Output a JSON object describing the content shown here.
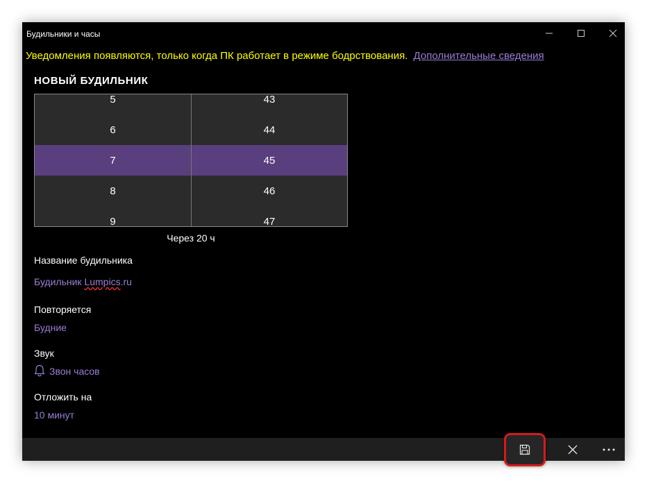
{
  "window": {
    "title": "Будильники и часы"
  },
  "notice": {
    "text": "Уведомления появляются, только когда ПК работает в режиме бодрствования.",
    "link": "Дополнительные сведения"
  },
  "page": {
    "heading": "НОВЫЙ БУДИЛЬНИК"
  },
  "time_picker": {
    "hours": [
      "5",
      "6",
      "7",
      "8",
      "9"
    ],
    "minutes": [
      "43",
      "44",
      "45",
      "46",
      "47"
    ],
    "selected_hour": "7",
    "selected_minute": "45",
    "remaining": "Через 20 ч"
  },
  "fields": {
    "name_label": "Название будильника",
    "name_prefix": "Будильник ",
    "name_misspelled": "Lumpics",
    "name_suffix": ".ru",
    "repeat_label": "Повторяется",
    "repeat_value": "Будние",
    "sound_label": "Звук",
    "sound_value": "Звон часов",
    "snooze_label": "Отложить на",
    "snooze_value": "10 минут"
  },
  "icons": {
    "minimize": "minimize-icon",
    "maximize": "maximize-icon",
    "close": "close-icon",
    "bell": "bell-icon",
    "save": "save-icon",
    "cancel": "close-icon",
    "more": "more-icon"
  },
  "colors": {
    "background": "#000000",
    "accent": "#9a7fd6",
    "selection": "#5a3f7f",
    "notice": "#ffff00",
    "highlight": "#d71a1a"
  }
}
